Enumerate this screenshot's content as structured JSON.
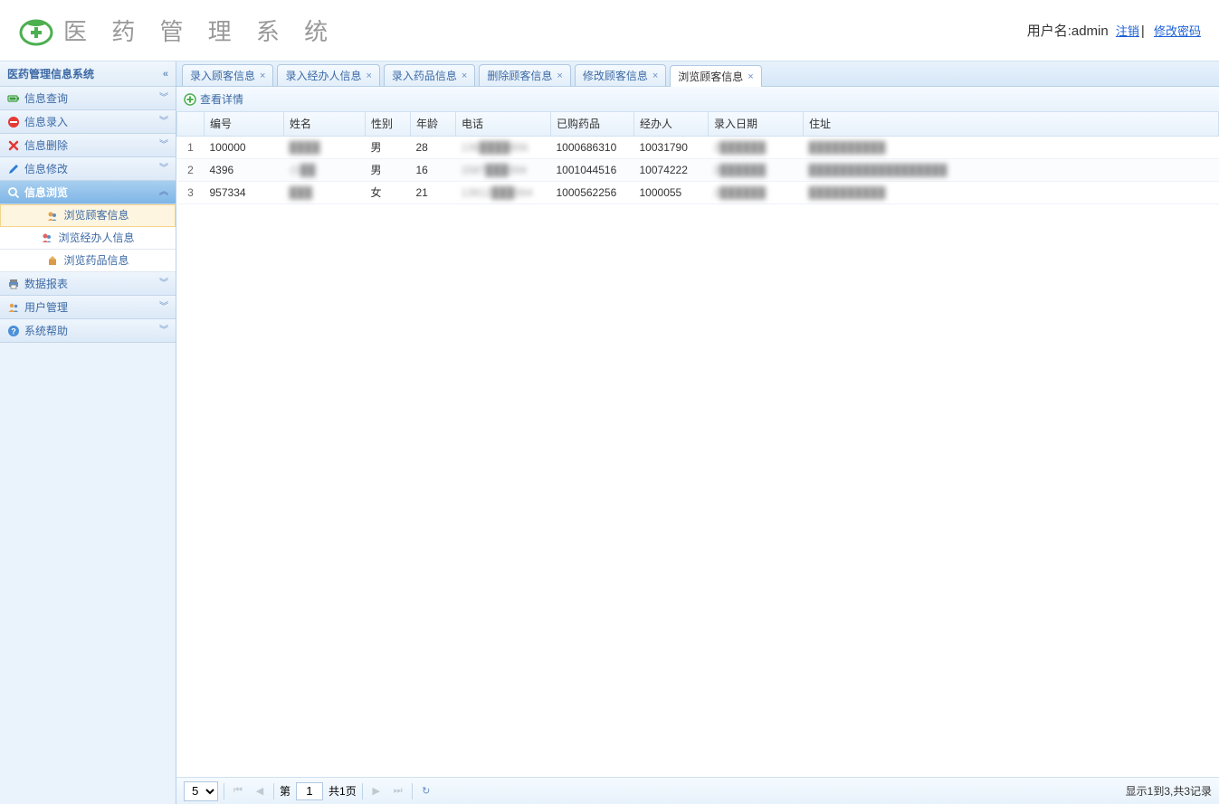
{
  "header": {
    "app_title": "医 药 管 理 系 统",
    "user_label": "用户名:",
    "username": "admin",
    "logout": "注销",
    "change_pwd": "修改密码"
  },
  "sidebar": {
    "title": "医药管理信息系统",
    "menus": [
      {
        "label": "信息查询",
        "icon": "battery"
      },
      {
        "label": "信息录入",
        "icon": "no-entry"
      },
      {
        "label": "信息删除",
        "icon": "delete"
      },
      {
        "label": "信息修改",
        "icon": "pencil"
      },
      {
        "label": "信息浏览",
        "icon": "search",
        "active": true
      },
      {
        "label": "数据报表",
        "icon": "printer"
      },
      {
        "label": "用户管理",
        "icon": "users"
      },
      {
        "label": "系统帮助",
        "icon": "help"
      }
    ],
    "submenus": [
      {
        "label": "浏览顾客信息",
        "selected": true
      },
      {
        "label": "浏览经办人信息"
      },
      {
        "label": "浏览药品信息"
      }
    ]
  },
  "tabs": [
    {
      "label": "录入顾客信息"
    },
    {
      "label": "录入经办人信息"
    },
    {
      "label": "录入药品信息"
    },
    {
      "label": "删除顾客信息"
    },
    {
      "label": "修改顾客信息"
    },
    {
      "label": "浏览顾客信息",
      "active": true
    }
  ],
  "toolbar": {
    "view_detail": "查看详情"
  },
  "grid": {
    "headers": [
      "",
      "编号",
      "姓名",
      "性别",
      "年龄",
      "电话",
      "已购药品",
      "经办人",
      "录入日期",
      "住址"
    ],
    "rows": [
      {
        "n": "1",
        "id": "100000",
        "name": "████",
        "sex": "男",
        "age": "28",
        "tel": "136████656",
        "bought": "1000686310",
        "agent": "10031790",
        "date": "2██████",
        "addr": "██████████"
      },
      {
        "n": "2",
        "id": "4396",
        "name": "小██",
        "sex": "男",
        "age": "16",
        "tel": "1587███004",
        "bought": "1001044516",
        "agent": "10074222",
        "date": "2██████",
        "addr": "██████████████████"
      },
      {
        "n": "3",
        "id": "957334",
        "name": "███",
        "sex": "女",
        "age": "21",
        "tel": "13612███564",
        "bought": "1000562256",
        "agent": "1000055",
        "date": "2██████",
        "addr": "██████████"
      }
    ]
  },
  "pager": {
    "page_size": "5",
    "page_label_pre": "第",
    "page_value": "1",
    "total_pages": "共1页",
    "summary": "显示1到3,共3记录"
  }
}
